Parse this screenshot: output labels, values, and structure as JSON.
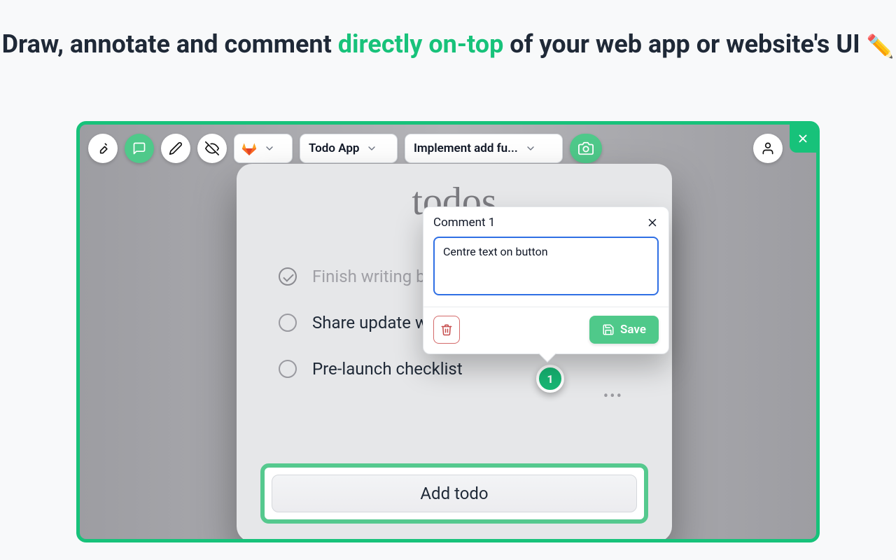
{
  "headline": {
    "prefix": "Draw, annotate and comment ",
    "accent": "directly on-top",
    "suffix": " of your web app or website's UI ",
    "emoji": "✏️"
  },
  "toolbar": {
    "project_label": "Todo App",
    "issue_label": "Implement add fu..."
  },
  "app": {
    "title": "todos",
    "items": [
      {
        "text": "Finish writing blog post",
        "done": true
      },
      {
        "text": "Share update with team",
        "done": false
      },
      {
        "text": "Pre-launch checklist",
        "done": false
      }
    ],
    "add_label": "Add todo"
  },
  "popover": {
    "title": "Comment 1",
    "text": "Centre text on button",
    "save_label": "Save"
  },
  "pin": {
    "number": "1"
  }
}
